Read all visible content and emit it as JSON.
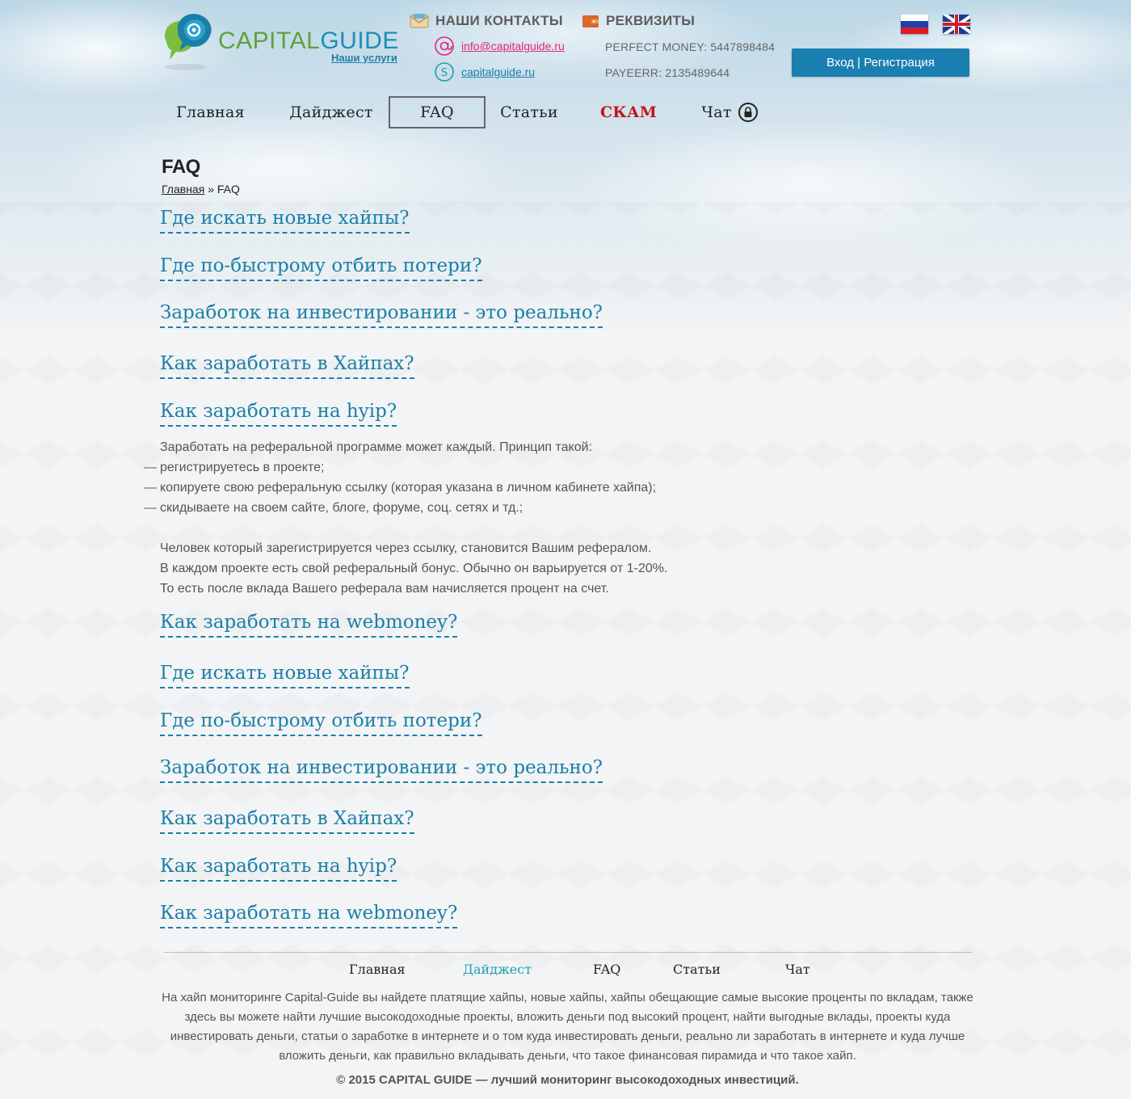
{
  "header": {
    "logo_part1": "CAPITAL",
    "logo_part2": "GUIDE",
    "services_link": "Наши услуги",
    "contacts_title": "НАШИ КОНТАКТЫ",
    "requisites_title": "РЕКВИЗИТЫ",
    "email": "info@capitalguide.ru",
    "skype": "capitalguide.ru",
    "perfect_money": "PERFECT MONEY: 5447898484",
    "payeer": "PAYEERR: 2135489644",
    "login_button": "Вход | Регистрация"
  },
  "nav": [
    {
      "label": "Главная"
    },
    {
      "label": "Дайджест"
    },
    {
      "label": "FAQ"
    },
    {
      "label": "Статьи"
    },
    {
      "label": "СКАМ"
    },
    {
      "label": "Чат"
    }
  ],
  "page": {
    "title": "FAQ",
    "breadcrumb_home": "Главная",
    "breadcrumb_sep": "»",
    "breadcrumb_current": "FAQ"
  },
  "faq": [
    {
      "question": "Где искать новые хайпы?"
    },
    {
      "question": "Где по-быстрому отбить потери?"
    },
    {
      "question": "Заработок на инвестировании - это реально?"
    },
    {
      "question": "Как заработать в Хайпах?"
    },
    {
      "question": "Как заработать на hyip?"
    },
    {
      "question": "Как заработать на webmoney?"
    },
    {
      "question": "Где искать новые хайпы?"
    },
    {
      "question": "Где по-быстрому отбить потери?"
    },
    {
      "question": "Заработок на инвестировании - это реально?"
    },
    {
      "question": "Как заработать в Хайпах?"
    },
    {
      "question": "Как заработать на hyip?"
    },
    {
      "question": "Как заработать на webmoney?"
    }
  ],
  "answer": {
    "intro": "Заработать на реферальной программе может каждый. Принцип такой:",
    "items": [
      "регистрируетесь в проекте;",
      "копируете свою реферальную ссылку (которая указана в личном кабинете хайпа);",
      "скидываете на своем сайте, блоге, форуме, соц. сетях и тд.;"
    ],
    "p1": "Человек который зарегистрируется через ссылку, становится Вашим рефералом.",
    "p2": "В каждом проекте есть свой реферальный бонус. Обычно он варьируется от 1-20%.",
    "p3": "То есть после вклада Вашего реферала вам начисляется процент на счет."
  },
  "footer": {
    "nav": [
      "Главная",
      "Дайджест",
      "FAQ",
      "Статьи",
      "Чат"
    ],
    "text": "На хайп мониторинге Capital-Guide вы найдете платящие хайпы, новые хайпы, хайпы обещающие самые высокие проценты по вкладам, также здесь вы можете найти лучшие высокодоходные проекты, вложить деньги под  высокий процент, найти выгодные вклады, проекты куда инвестировать деньги, статьи о заработке в интернете и о том куда инвестировать деньги, реально ли заработать в интернете и куда лучше вложить деньги, как правильно вкладывать деньги, что такое финансовая пирамида и что такое хайп.",
    "copyright": "© 2015 CAPITAL GUIDE — лучший мониторинг высокодоходных инвестиций."
  },
  "colors": {
    "accent_blue": "#1b7fa8",
    "button_blue": "#1a7fb1",
    "scam_red": "#c4141b",
    "email_pink": "#e0257b",
    "skype_teal": "#19a0a8",
    "logo_green": "#5fa13a",
    "footer_active": "#1a9fae"
  },
  "icons": {
    "contacts": "envelope-icon",
    "requisites": "wallet-icon",
    "email": "at-sign-icon",
    "skype": "skype-icon",
    "chat": "lock-icon"
  }
}
